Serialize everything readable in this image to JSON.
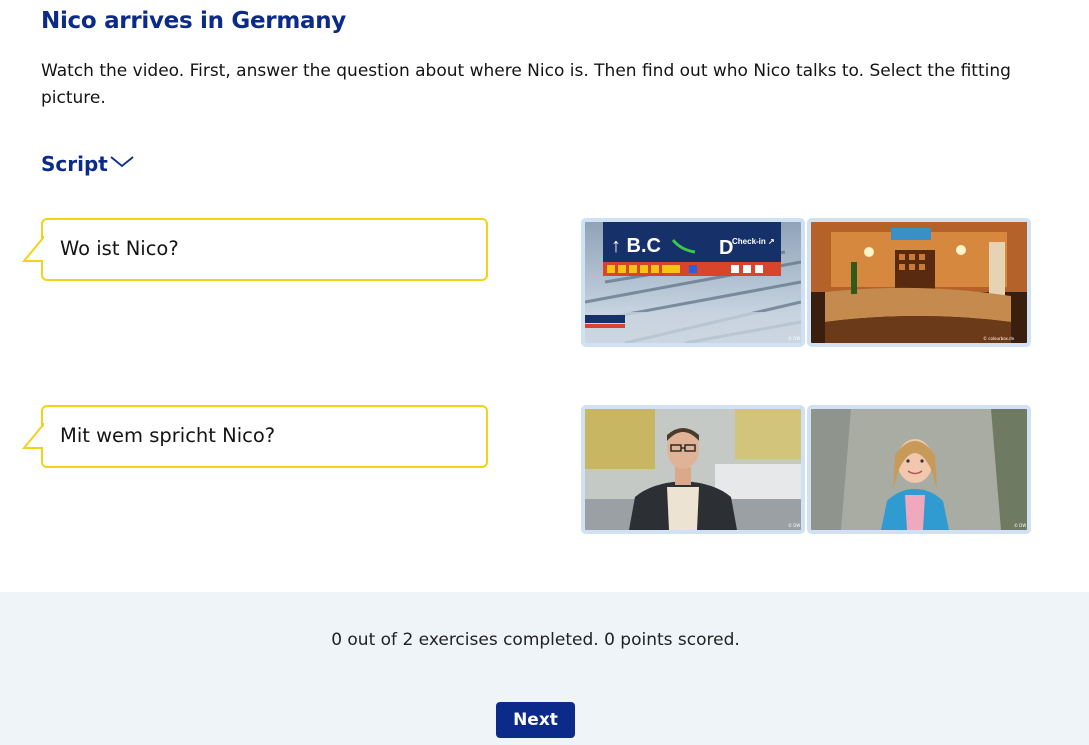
{
  "title": "Nico arrives in Germany",
  "instructions": "Watch the video. First, answer the question about where Nico is. Then find out who Nico talks to. Select the fitting picture.",
  "script_toggle": {
    "label": "Script",
    "icon": "chevron-down-icon"
  },
  "exercises": [
    {
      "question": "Wo ist Nico?",
      "options": [
        {
          "name": "airport-terminal-image",
          "sign_left": "↑ B.C",
          "sign_right": "D",
          "sign_small": "Check-in ↗",
          "credit": "© DW"
        },
        {
          "name": "hotel-reception-image",
          "credit": "© colourbox.de"
        }
      ]
    },
    {
      "question": "Mit wem spricht Nico?",
      "options": [
        {
          "name": "man-with-glasses-image",
          "credit": "© DW"
        },
        {
          "name": "girl-with-backpack-image",
          "credit": "© DW"
        }
      ]
    }
  ],
  "footer": {
    "status": "0 out of 2 exercises completed. 0 points scored.",
    "next_label": "Next"
  },
  "colors": {
    "brand": "#0b2a8a",
    "bubble_border": "#f2d21a",
    "option_border": "#cfe1f2",
    "footer_bg": "#eff4f8"
  }
}
